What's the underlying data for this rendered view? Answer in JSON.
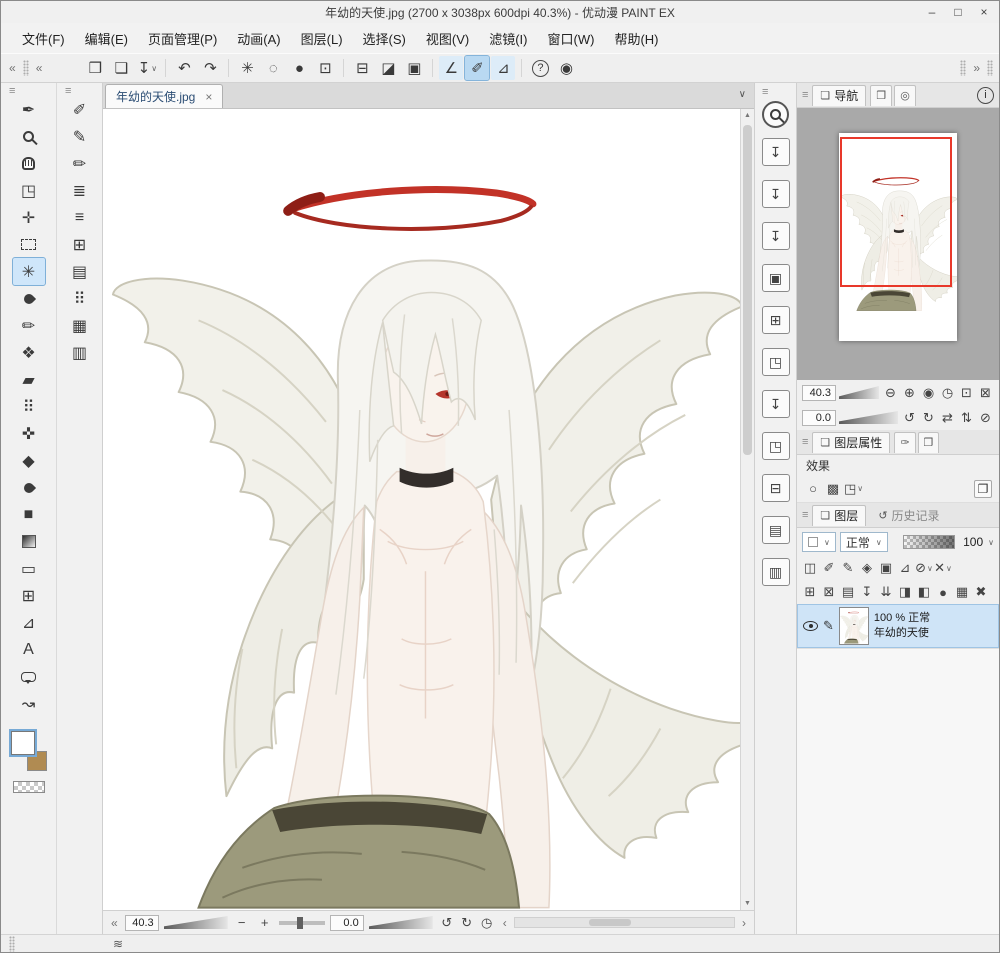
{
  "colors": {
    "accent_blue": "#7fb0d8",
    "selected_bg": "#cfe4f7",
    "halo_red": "#c23227",
    "panel_bg": "#f0f0f0",
    "navigator_view_rect": "#e8382a",
    "sub_color": "#b08b52"
  },
  "glyphs": {
    "dropdown": "∨",
    "panel_tab": "❏",
    "history": "↺",
    "scroll_up": "▲",
    "scroll_down": "▼",
    "chevron_left": "«",
    "chevron_right": "»"
  },
  "titlebar": {
    "title": "年幼的天使.jpg (2700 x 3038px 600dpi 40.3%)  - 优动漫 PAINT EX",
    "minimize": "–",
    "maximize": "□",
    "close": "×"
  },
  "menubar": {
    "items": [
      "文件(F)",
      "编辑(E)",
      "页面管理(P)",
      "动画(A)",
      "图层(L)",
      "选择(S)",
      "视图(V)",
      "滤镜(I)",
      "窗口(W)",
      "帮助(H)"
    ]
  },
  "command_bar": {
    "buttons": [
      {
        "name": "new-document-button",
        "glyph": "❒"
      },
      {
        "name": "open-file-button",
        "glyph": "❏"
      },
      {
        "name": "save-file-button",
        "glyph": "↧",
        "dropdown": true
      },
      {
        "sep": true
      },
      {
        "name": "undo-button",
        "glyph": "↶"
      },
      {
        "name": "redo-button",
        "glyph": "↷"
      },
      {
        "sep": true
      },
      {
        "name": "deselect-button",
        "glyph": "✳"
      },
      {
        "name": "reselect-button",
        "glyph": "◌"
      },
      {
        "name": "invert-selection-button",
        "glyph": "●"
      },
      {
        "name": "crop-canvas-button",
        "glyph": "⊡"
      },
      {
        "sep": true
      },
      {
        "name": "launch-selection-button",
        "glyph": "⊟"
      },
      {
        "name": "quick-mask-button",
        "glyph": "◪"
      },
      {
        "name": "selection-area-button",
        "glyph": "▣"
      },
      {
        "sep": true
      },
      {
        "name": "snap-to-ruler-button",
        "glyph": "∠",
        "light": true
      },
      {
        "name": "snap-to-special-ruler-button",
        "glyph": "✐",
        "light": true,
        "active": true
      },
      {
        "name": "snap-to-grid-button",
        "glyph": "⊿",
        "light": true
      },
      {
        "sep": true
      },
      {
        "name": "help-button",
        "glyph": "?",
        "circled": true
      },
      {
        "name": "quick-access-button",
        "glyph": "◉"
      }
    ]
  },
  "tool_palette": {
    "tools": [
      {
        "name": "brush-tool",
        "glyph": "✒"
      },
      {
        "name": "zoom-tool",
        "css": "mag"
      },
      {
        "name": "hand-tool",
        "css": "hand"
      },
      {
        "name": "operate-tool",
        "glyph": "◳"
      },
      {
        "name": "move-layer-tool",
        "glyph": "✛"
      },
      {
        "name": "selection-tool",
        "css": "marquee"
      },
      {
        "name": "auto-select-tool",
        "glyph": "✳",
        "selected": true
      },
      {
        "name": "eyedropper-tool",
        "css": "drop"
      },
      {
        "name": "pen-tool",
        "glyph": "✏"
      },
      {
        "name": "pencil-tool",
        "glyph": "❖"
      },
      {
        "name": "eraser-tool",
        "glyph": "▰"
      },
      {
        "name": "airbrush-tool",
        "glyph": "⠿"
      },
      {
        "name": "mix-color-tool",
        "glyph": "✜"
      },
      {
        "name": "decoration-tool",
        "glyph": "◆"
      },
      {
        "name": "blend-tool",
        "css": "drop"
      },
      {
        "name": "fill-tool",
        "glyph": "■"
      },
      {
        "name": "gradient-tool",
        "css": "grad"
      },
      {
        "name": "figure-tool",
        "glyph": "▭"
      },
      {
        "name": "frame-border-tool",
        "glyph": "⊞"
      },
      {
        "name": "ruler-tool",
        "glyph": "⊿"
      },
      {
        "name": "text-tool",
        "glyph": "A"
      },
      {
        "name": "balloon-tool",
        "css": "balloon"
      },
      {
        "name": "line-correction-tool",
        "glyph": "↝"
      }
    ]
  },
  "sub_tool_palette": {
    "tools": [
      {
        "name": "subtool-pen-1",
        "glyph": "✐"
      },
      {
        "name": "subtool-pen-2",
        "glyph": "✎"
      },
      {
        "name": "subtool-pencil",
        "glyph": "✏"
      },
      {
        "name": "subtool-round-brush",
        "glyph": "≣"
      },
      {
        "name": "subtool-lines",
        "glyph": "≡"
      },
      {
        "name": "subtool-grid",
        "glyph": "⊞"
      },
      {
        "name": "subtool-rows",
        "glyph": "▤"
      },
      {
        "name": "subtool-dots",
        "glyph": "⠿"
      },
      {
        "name": "subtool-mesh",
        "glyph": "▦"
      },
      {
        "name": "subtool-film",
        "glyph": "▥"
      }
    ]
  },
  "document_tab": {
    "label": "年幼的天使.jpg",
    "close_glyph": "×",
    "list_dropdown_glyph": "∨"
  },
  "canvas_footer": {
    "collapse_glyph": "«",
    "zoom_value": "40.3",
    "zoom_out_glyph": "−",
    "zoom_in_glyph": "+",
    "rotation_value": "0.0",
    "view_buttons": [
      {
        "name": "undo-history-button",
        "glyph": "↺"
      },
      {
        "name": "redo-history-button",
        "glyph": "↻"
      },
      {
        "name": "reset-view-button",
        "glyph": "◷"
      }
    ],
    "scroll_left_glyph": "‹",
    "scroll_right_glyph": "›"
  },
  "quick_bar": {
    "buttons": [
      {
        "name": "collapsed-palette-1-button",
        "glyph": "↧"
      },
      {
        "name": "collapsed-palette-2-button",
        "glyph": "↧"
      },
      {
        "name": "collapsed-palette-3-button",
        "glyph": "↧"
      },
      {
        "name": "collapsed-palette-4-button",
        "glyph": "▣"
      },
      {
        "name": "collapsed-palette-5-button",
        "glyph": "⊞"
      },
      {
        "name": "collapsed-palette-6-button",
        "glyph": "◳"
      },
      {
        "name": "collapsed-palette-7-button",
        "glyph": "↧"
      },
      {
        "name": "collapsed-palette-8-button",
        "glyph": "◳"
      },
      {
        "name": "collapsed-palette-9-button",
        "glyph": "⊟"
      },
      {
        "name": "collapsed-palette-10-button",
        "glyph": "▤"
      },
      {
        "name": "collapsed-palette-11-button",
        "glyph": "▥"
      }
    ]
  },
  "navigator": {
    "tab_label": "导航",
    "icon_tabs": [
      {
        "name": "subview-tab",
        "glyph": "❐"
      },
      {
        "name": "item-bank-tab",
        "glyph": "◎"
      }
    ],
    "info_glyph": "i",
    "zoom_value": "40.3",
    "zoom_buttons": [
      {
        "name": "nav-zoom-out-button",
        "glyph": "⊖"
      },
      {
        "name": "nav-zoom-in-button",
        "glyph": "⊕"
      },
      {
        "name": "nav-actual-size-button",
        "glyph": "◉"
      },
      {
        "name": "nav-fit-screen-button",
        "glyph": "◷"
      },
      {
        "name": "nav-fit-width-button",
        "glyph": "⊡"
      },
      {
        "name": "nav-full-view-button",
        "glyph": "⊠"
      }
    ],
    "rotation_value": "0.0",
    "rotate_buttons": [
      {
        "name": "rotate-left-button",
        "glyph": "↺"
      },
      {
        "name": "rotate-right-button",
        "glyph": "↻"
      },
      {
        "name": "flip-horizontal-button",
        "glyph": "⇄"
      },
      {
        "name": "flip-vertical-button",
        "glyph": "⇅"
      },
      {
        "name": "reset-rotation-button",
        "glyph": "⊘"
      }
    ]
  },
  "layer_properties": {
    "tab_label": "图层属性",
    "icon_tabs": [
      {
        "name": "tool-property-tab",
        "glyph": "✑"
      },
      {
        "name": "brush-detail-tab",
        "glyph": "❐"
      }
    ],
    "effects_label": "效果",
    "effect_buttons": [
      {
        "name": "border-effect-button",
        "glyph": "○"
      },
      {
        "name": "tone-effect-button",
        "glyph": "▩"
      },
      {
        "name": "expression-color-button",
        "glyph": "◳",
        "dropdown": true
      }
    ],
    "panel_option_glyph": "❐"
  },
  "layer_panel": {
    "tab_label": "图层",
    "history_tab_label": "历史记录",
    "blend_mode": "正常",
    "opacity_value": "100",
    "toolbar_row1": [
      {
        "name": "clip-to-layer-below-button",
        "glyph": "◫"
      },
      {
        "name": "reference-layer-button",
        "glyph": "✐"
      },
      {
        "name": "draft-layer-button",
        "glyph": "✎"
      },
      {
        "name": "lock-layer-button",
        "glyph": "◈"
      },
      {
        "name": "lock-transparent-pixels-button",
        "glyph": "▣"
      },
      {
        "name": "enable-mask-button",
        "glyph": "⊿"
      },
      {
        "name": "ruler-range-button",
        "glyph": "⊘",
        "dropdown": true
      },
      {
        "name": "set-as-selection-button",
        "glyph": "✕",
        "dropdown": true
      }
    ],
    "toolbar_row2": [
      {
        "name": "new-raster-layer-button",
        "glyph": "⊞"
      },
      {
        "name": "new-vector-layer-button",
        "glyph": "⊠"
      },
      {
        "name": "new-layer-folder-button",
        "glyph": "▤"
      },
      {
        "name": "transfer-to-lower-layer-button",
        "glyph": "↧"
      },
      {
        "name": "merge-with-lower-layer-button",
        "glyph": "⇊"
      },
      {
        "name": "create-layer-mask-button",
        "glyph": "◨"
      },
      {
        "name": "apply-mask-button",
        "glyph": "◧"
      },
      {
        "name": "mask-indicator-button",
        "glyph": "●"
      },
      {
        "name": "layer-settings-button",
        "glyph": "▦"
      },
      {
        "name": "delete-layer-button",
        "glyph": "✖"
      }
    ],
    "layer": {
      "status": "100 % 正常",
      "name": "年幼的天使"
    }
  },
  "status_bar": {
    "wave_glyph": "≋"
  }
}
